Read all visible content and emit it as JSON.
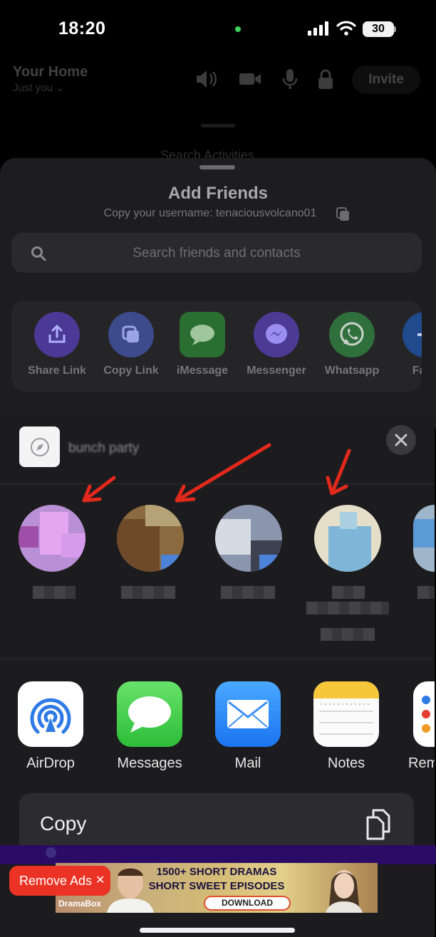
{
  "status_bar": {
    "time": "18:20",
    "battery": "30"
  },
  "background_app": {
    "title": "Your Home",
    "subtitle": "Just you ⌄",
    "invite_label": "Invite",
    "search_placeholder": "Search Activities"
  },
  "add_friends": {
    "title": "Add Friends",
    "username_line": "Copy your username: tenaciousvolcano01",
    "search_placeholder": "Search friends and contacts",
    "share_options": [
      {
        "label": "Share Link",
        "icon": "share-upload-icon",
        "color": "#5b3fd6"
      },
      {
        "label": "Copy Link",
        "icon": "copy-link-icon",
        "color": "#5160d3"
      },
      {
        "label": "iMessage",
        "icon": "imessage-icon",
        "color": "#35c759"
      },
      {
        "label": "Messenger",
        "icon": "messenger-icon",
        "color": "#7b4bf2"
      },
      {
        "label": "Whatsapp",
        "icon": "whatsapp-icon",
        "color": "#25d366"
      },
      {
        "label": "Face",
        "icon": "facebook-icon",
        "color": "#1877f2"
      }
    ]
  },
  "share_sheet": {
    "link_title": "bunch party",
    "apps": [
      {
        "label": "AirDrop",
        "icon": "airdrop-icon"
      },
      {
        "label": "Messages",
        "icon": "messages-icon"
      },
      {
        "label": "Mail",
        "icon": "mail-icon"
      },
      {
        "label": "Notes",
        "icon": "notes-icon"
      },
      {
        "label": "Rem",
        "icon": "reminders-icon"
      }
    ],
    "copy_label": "Copy"
  },
  "ad": {
    "line1": "1500+ SHORT DRAMAS",
    "line2": "SHORT SWEET EPISODES",
    "download_label": "DOWNLOAD",
    "brand": "DramaBox",
    "remove_ads_label": "Remove Ads",
    "close_symbol": "✕"
  }
}
